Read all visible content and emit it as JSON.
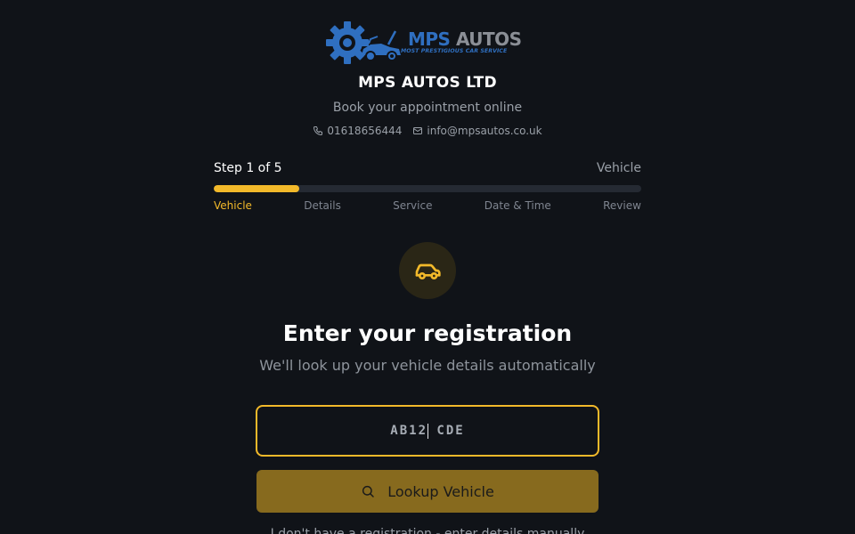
{
  "logo": {
    "brand_primary": "MPS",
    "brand_secondary": "AUTOS",
    "tagline": "MOST PRESTIGIOUS CAR SERVICE",
    "icon": "gear-car-logo"
  },
  "header": {
    "company_name": "MPS AUTOS LTD",
    "tagline": "Book your appointment online",
    "phone": "01618656444",
    "email": "info@mpsautos.co.uk"
  },
  "progress": {
    "step_label": "Step 1 of 5",
    "current_step_name": "Vehicle",
    "fraction_complete": 0.2,
    "steps": [
      "Vehicle",
      "Details",
      "Service",
      "Date & Time",
      "Review"
    ],
    "active_index": 0
  },
  "main": {
    "icon": "car-icon",
    "title": "Enter your registration",
    "subtitle": "We'll look up your vehicle details automatically",
    "registration_input": {
      "placeholder": "AB12 CDE",
      "value": ""
    },
    "lookup_button": "Lookup Vehicle",
    "manual_entry_link": "I don't have a registration - enter details manually"
  },
  "colors": {
    "background": "#101318",
    "accent": "#f2b92a",
    "button_bg": "#876a1e",
    "brand_blue": "#2f6fc0",
    "muted_text": "#9aa0a8"
  }
}
